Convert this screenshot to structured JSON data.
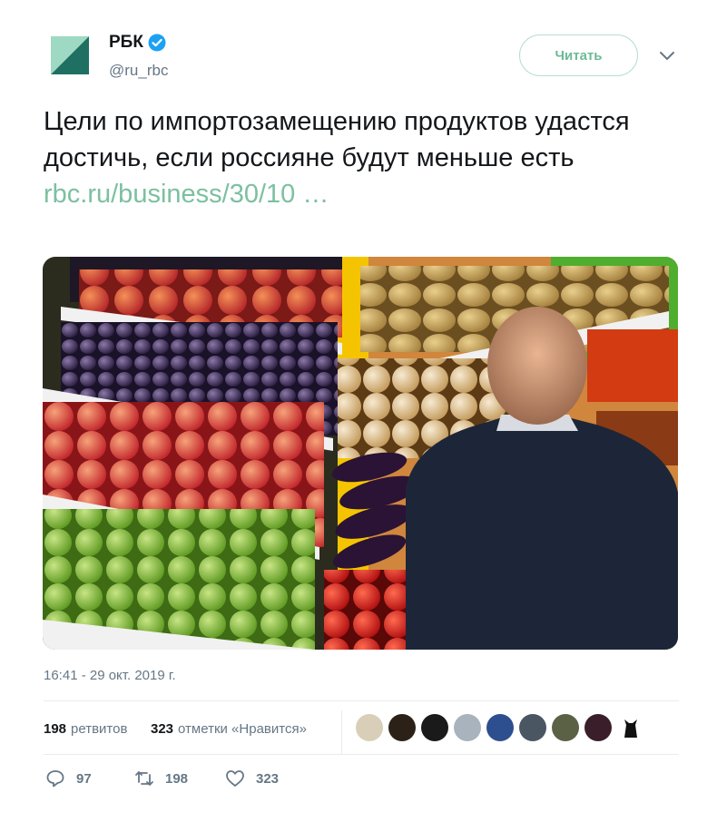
{
  "author": {
    "name": "РБК",
    "handle": "@ru_rbc",
    "verified": true,
    "follow_label": "Читать"
  },
  "tweet": {
    "text": "Цели по импортозамещению продуктов удастся достичь, если россияне будут меньше есть",
    "link": "rbc.ru/business/30/10 …",
    "timestamp": "16:41 - 29 окт. 2019 г."
  },
  "stats": {
    "retweets_count": "198",
    "retweets_label": "ретвитов",
    "likes_count": "323",
    "likes_label": "отметки «Нравится»"
  },
  "actions": {
    "replies": "97",
    "retweets": "198",
    "likes": "323"
  },
  "colors": {
    "brand_accent": "#7cc0a0",
    "verified_blue": "#1da1f2",
    "muted": "#657786"
  }
}
